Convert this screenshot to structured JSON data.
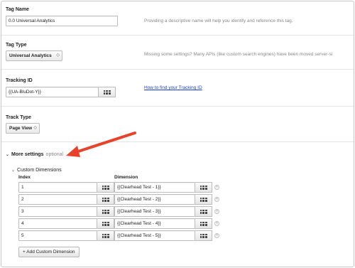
{
  "tag_name": {
    "label": "Tag Name",
    "value": "0.0 Universal Analytics",
    "help": "Providing a descriptive name will help you identify and reference this tag."
  },
  "tag_type": {
    "label": "Tag Type",
    "value": "Universal Analytics",
    "arrows": "◇",
    "help": "Missing some settings? Many APIs (like custom search engines) have been moved server-si"
  },
  "tracking_id": {
    "label": "Tracking ID",
    "value": "{{UA-BluDot-Y}}",
    "link": "How to find your Tracking ID"
  },
  "track_type": {
    "label": "Track Type",
    "value": "Page View",
    "arrows": "◇"
  },
  "more_settings": {
    "chevron": "⌄",
    "label": "More settings",
    "optional": "optional"
  },
  "custom_dimensions": {
    "chevron": "⌄",
    "label": "Custom Dimensions",
    "index_header": "Index",
    "dimension_header": "Dimension",
    "remove_glyph": "×",
    "rows": [
      {
        "index": "1",
        "dimension": "{{Clearhead Test - 1}}"
      },
      {
        "index": "2",
        "dimension": "{{Clearhead Test - 2}}"
      },
      {
        "index": "3",
        "dimension": "{{Clearhead Test - 3}}"
      },
      {
        "index": "4",
        "dimension": "{{Clearhead Test - 4}}"
      },
      {
        "index": "5",
        "dimension": "{{Clearhead Test - 5}}"
      }
    ],
    "add_button": "+ Add Custom Dimension"
  },
  "colors": {
    "arrow": "#e8432a",
    "link": "#1a3fd0",
    "help_text": "#888888"
  }
}
